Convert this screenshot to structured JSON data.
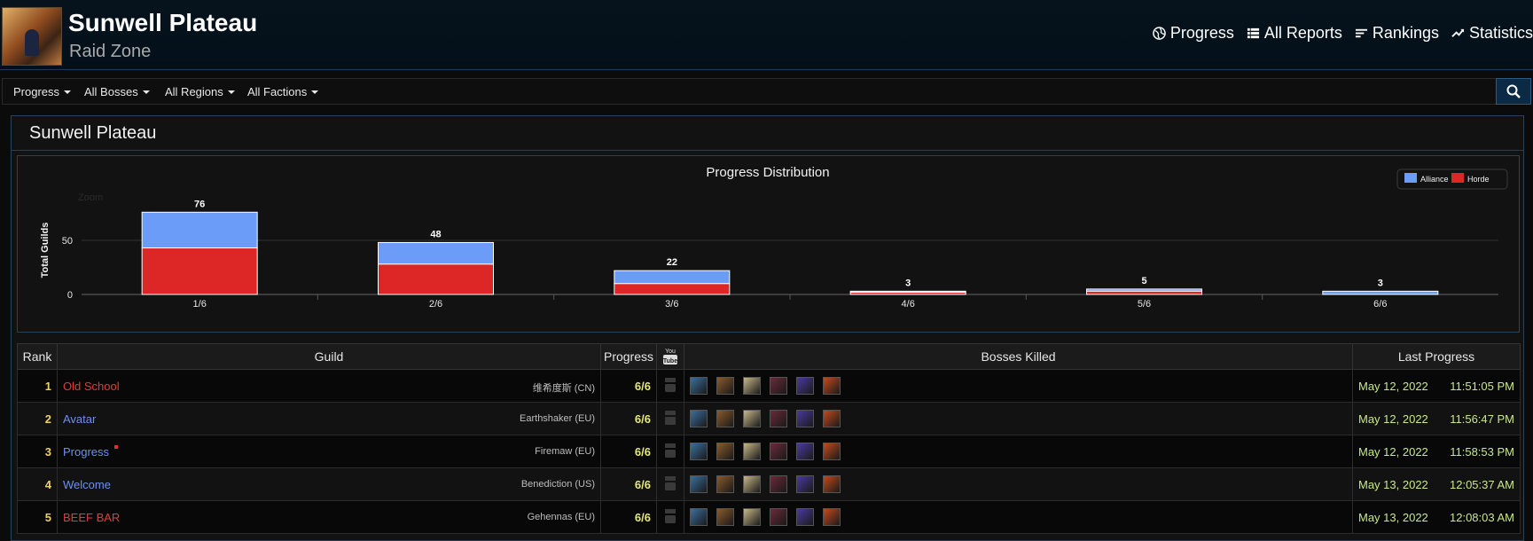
{
  "header": {
    "title": "Sunwell Plateau",
    "subtitle": "Raid Zone",
    "nav": [
      {
        "label": "Progress",
        "icon": "globe-icon"
      },
      {
        "label": "All Reports",
        "icon": "list-icon"
      },
      {
        "label": "Rankings",
        "icon": "sort-icon"
      },
      {
        "label": "Statistics",
        "icon": "trend-icon"
      }
    ]
  },
  "filters": [
    "Progress",
    "All Bosses",
    "All Regions",
    "All Factions"
  ],
  "panel": {
    "title": "Sunwell Plateau"
  },
  "chart_data": {
    "type": "bar",
    "title": "Progress Distribution",
    "ylabel": "Total Guilds",
    "zoom_label": "Zoom",
    "categories": [
      "1/6",
      "2/6",
      "3/6",
      "4/6",
      "5/6",
      "6/6"
    ],
    "totals": [
      76,
      48,
      22,
      3,
      5,
      3
    ],
    "series": [
      {
        "name": "Alliance",
        "color": "#6a9cf8",
        "values": [
          33,
          20,
          12,
          1,
          2,
          3
        ]
      },
      {
        "name": "Horde",
        "color": "#dd2727",
        "values": [
          43,
          28,
          10,
          2,
          3,
          0
        ]
      }
    ],
    "stacked": true,
    "yticks": [
      0,
      50
    ],
    "ylim": [
      0,
      80
    ],
    "legend_position": "top-right"
  },
  "table": {
    "headers": {
      "rank": "Rank",
      "guild": "Guild",
      "progress": "Progress",
      "bosses": "Bosses Killed",
      "last": "Last Progress"
    },
    "rows": [
      {
        "rank": "1",
        "guild": "Old School",
        "faction_color": "#e03c3c",
        "server": "维希度斯 (CN)",
        "progress": "6/6",
        "date": "May 12, 2022",
        "time": "11:51:05 PM",
        "flag": false
      },
      {
        "rank": "2",
        "guild": "Avatar",
        "faction_color": "#6f8ff0",
        "server": "Earthshaker (EU)",
        "progress": "6/6",
        "date": "May 12, 2022",
        "time": "11:56:47 PM",
        "flag": false
      },
      {
        "rank": "3",
        "guild": "Progress",
        "faction_color": "#6f8ff0",
        "server": "Firemaw (EU)",
        "progress": "6/6",
        "date": "May 12, 2022",
        "time": "11:58:53 PM",
        "flag": true
      },
      {
        "rank": "4",
        "guild": "Welcome",
        "faction_color": "#6f8ff0",
        "server": "Benediction (US)",
        "progress": "6/6",
        "date": "May 13, 2022",
        "time": "12:05:37 AM",
        "flag": false
      },
      {
        "rank": "5",
        "guild": "BEEF BAR",
        "faction_color": "#e03c3c",
        "server": "Gehennas (EU)",
        "progress": "6/6",
        "date": "May 13, 2022",
        "time": "12:08:03 AM",
        "flag": false
      }
    ],
    "boss_icons": [
      "kalecgos-icon",
      "brutallus-icon",
      "felmyst-icon",
      "eredar-twins-icon",
      "muru-icon",
      "kiljaeden-icon"
    ]
  }
}
